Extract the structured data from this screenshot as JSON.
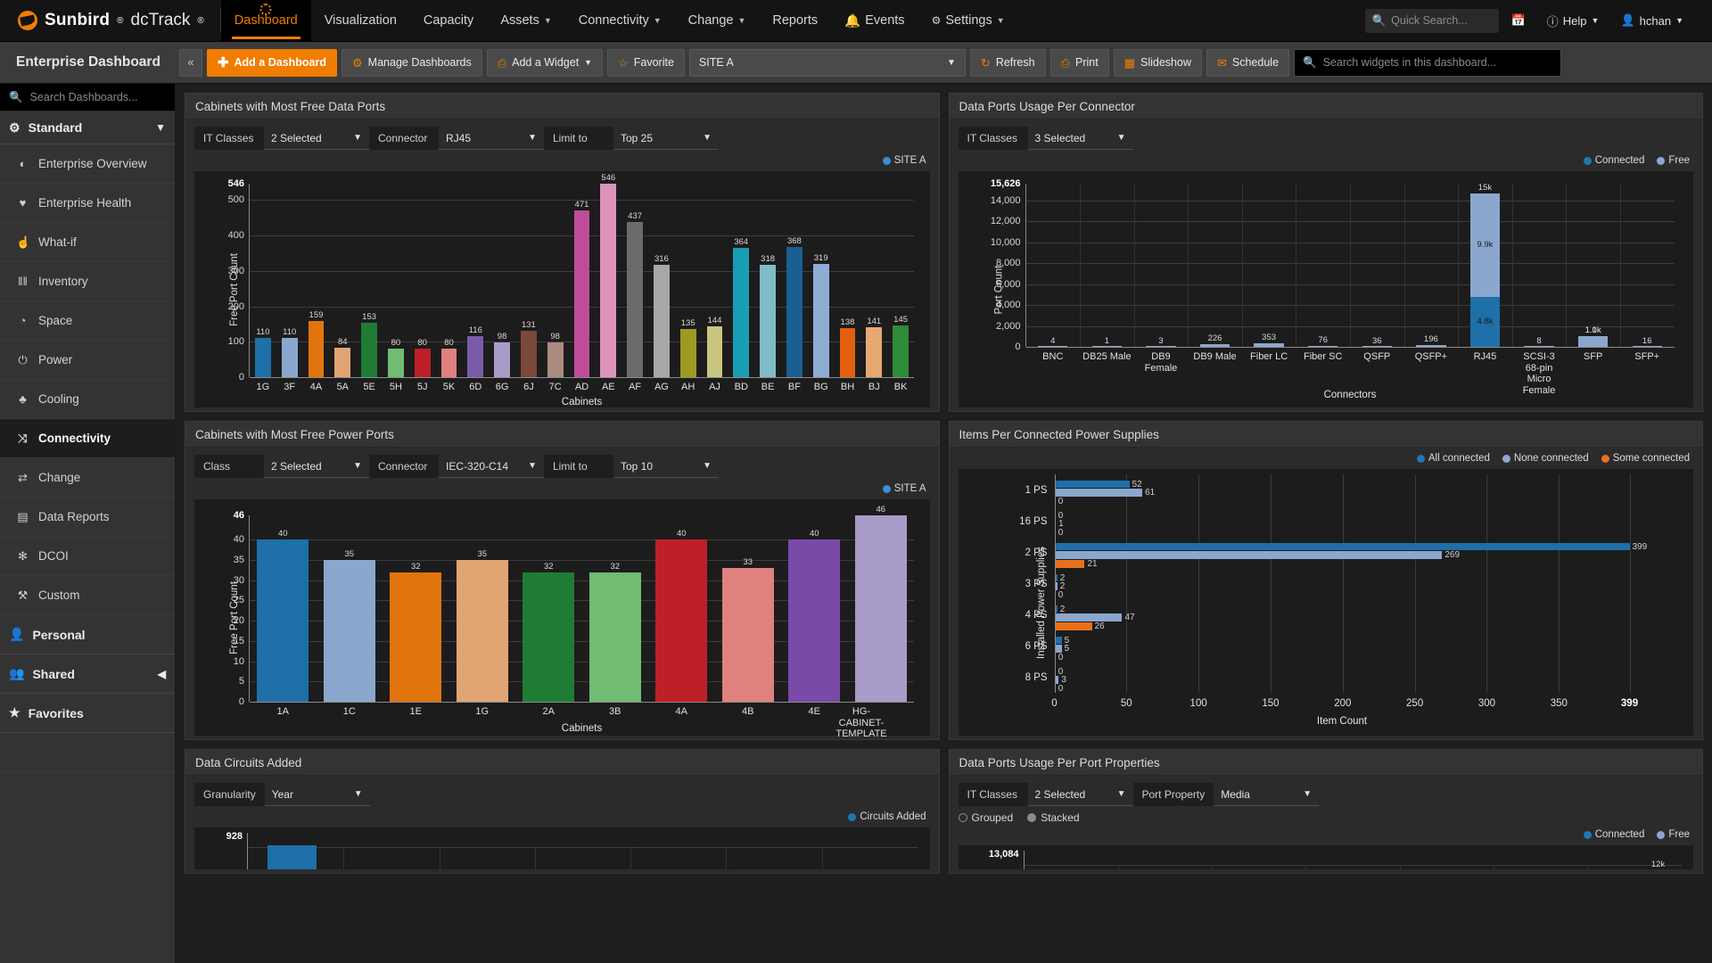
{
  "brand": {
    "name": "Sunbird",
    "sup": "®",
    "product": "dcTrack",
    "product_sup": "®"
  },
  "topnav": {
    "items": [
      {
        "label": "Dashboard",
        "caret": false,
        "active": true,
        "icon": ""
      },
      {
        "label": "Visualization",
        "caret": false,
        "active": false,
        "icon": ""
      },
      {
        "label": "Capacity",
        "caret": false,
        "active": false,
        "icon": ""
      },
      {
        "label": "Assets",
        "caret": true,
        "active": false,
        "icon": ""
      },
      {
        "label": "Connectivity",
        "caret": true,
        "active": false,
        "icon": ""
      },
      {
        "label": "Change",
        "caret": true,
        "active": false,
        "icon": ""
      },
      {
        "label": "Reports",
        "caret": false,
        "active": false,
        "icon": ""
      },
      {
        "label": "Events",
        "caret": false,
        "active": false,
        "icon": "bell"
      },
      {
        "label": "Settings",
        "caret": true,
        "active": false,
        "icon": "gear"
      }
    ],
    "quick_search_placeholder": "Quick Search...",
    "help_label": "Help",
    "user_label": "hchan"
  },
  "toolbar": {
    "title": "Enterprise Dashboard",
    "collapse_label": "«",
    "add_dashboard": "Add a Dashboard",
    "manage_dashboards": "Manage Dashboards",
    "add_widget": "Add a Widget",
    "favorite": "Favorite",
    "site_value": "SITE A",
    "refresh": "Refresh",
    "print": "Print",
    "slideshow": "Slideshow",
    "schedule": "Schedule",
    "widget_search_placeholder": "Search widgets in this dashboard..."
  },
  "sidebar": {
    "search_placeholder": "Search Dashboards...",
    "group_label": "Standard",
    "items": [
      {
        "label": "Enterprise Overview",
        "icon": "globe-icon",
        "glyph": "◐"
      },
      {
        "label": "Enterprise Health",
        "icon": "heartbeat-icon",
        "glyph": "♥"
      },
      {
        "label": "What-if",
        "icon": "thumbs-up-icon",
        "glyph": "☝"
      },
      {
        "label": "Inventory",
        "icon": "bars-icon",
        "glyph": "‖‖"
      },
      {
        "label": "Space",
        "icon": "gauge-icon",
        "glyph": "◔"
      },
      {
        "label": "Power",
        "icon": "power-icon",
        "glyph": "⏻"
      },
      {
        "label": "Cooling",
        "icon": "droplet-icon",
        "glyph": "♣"
      },
      {
        "label": "Connectivity",
        "icon": "shuffle-icon",
        "glyph": "⤨",
        "active": true
      },
      {
        "label": "Change",
        "icon": "exchange-icon",
        "glyph": "⇄"
      },
      {
        "label": "Data Reports",
        "icon": "report-icon",
        "glyph": "▤"
      },
      {
        "label": "DCOI",
        "icon": "asterisk-icon",
        "glyph": "✻"
      },
      {
        "label": "Custom",
        "icon": "wrench-icon",
        "glyph": "⚒"
      }
    ],
    "personal_label": "Personal",
    "shared_label": "Shared",
    "favorites_label": "Favorites"
  },
  "colors": {
    "accent": "#f07d00",
    "connected": "#1f77b4",
    "free": "#8ba7ce",
    "some_connected": "#e8701a",
    "site_a": "#3b8fd4"
  },
  "widgets": [
    {
      "title": "Cabinets with Most Free Data Ports",
      "filters": [
        {
          "label": "IT Classes",
          "value": "2 Selected"
        },
        {
          "label": "Connector",
          "value": "RJ45"
        },
        {
          "label": "Limit to",
          "value": "Top 25"
        }
      ],
      "legend": [
        {
          "label": "SITE A",
          "color": "#3b8fd4"
        }
      ]
    },
    {
      "title": "Data Ports Usage Per Connector",
      "filters": [
        {
          "label": "IT Classes",
          "value": "3 Selected"
        }
      ],
      "legend": [
        {
          "label": "Connected",
          "color": "#1f77b4"
        },
        {
          "label": "Free",
          "color": "#8ba7ce"
        }
      ]
    },
    {
      "title": "Cabinets with Most Free Power Ports",
      "filters": [
        {
          "label": "Class",
          "value": "2 Selected"
        },
        {
          "label": "Connector",
          "value": "IEC-320-C14"
        },
        {
          "label": "Limit to",
          "value": "Top 10"
        }
      ],
      "legend": [
        {
          "label": "SITE A",
          "color": "#3b8fd4"
        }
      ]
    },
    {
      "title": "Items Per Connected Power Supplies",
      "filters": [],
      "legend": [
        {
          "label": "All connected",
          "color": "#1f77b4"
        },
        {
          "label": "None connected",
          "color": "#8ba7ce"
        },
        {
          "label": "Some connected",
          "color": "#e8701a"
        }
      ]
    },
    {
      "title": "Data Circuits Added",
      "filters": [
        {
          "label": "Granularity",
          "value": "Year"
        }
      ],
      "legend": [
        {
          "label": "Circuits Added",
          "color": "#1f77b4"
        }
      ]
    },
    {
      "title": "Data Ports Usage Per Port Properties",
      "filters": [
        {
          "label": "IT Classes",
          "value": "2 Selected"
        },
        {
          "label": "Port Property",
          "value": "Media"
        }
      ],
      "radios": [
        {
          "label": "Grouped",
          "selected": false
        },
        {
          "label": "Stacked",
          "selected": true
        }
      ],
      "legend": [
        {
          "label": "Connected",
          "color": "#1f77b4"
        },
        {
          "label": "Free",
          "color": "#8ba7ce"
        }
      ]
    }
  ],
  "chart_data": [
    {
      "type": "bar",
      "title": "Cabinets with Most Free Data Ports",
      "xlabel": "Cabinets",
      "ylabel": "Free Port Count",
      "ylim": [
        0,
        546
      ],
      "yticks": [
        0,
        100,
        200,
        300,
        400,
        500
      ],
      "ymax_label": "546",
      "grid": true,
      "categories": [
        "1G",
        "3F",
        "4A",
        "5A",
        "5E",
        "5H",
        "5J",
        "5K",
        "6D",
        "6G",
        "6J",
        "7C",
        "AD",
        "AE",
        "AF",
        "AG",
        "AH",
        "AJ",
        "BD",
        "BE",
        "BF",
        "BG",
        "BH",
        "BJ",
        "BK"
      ],
      "values": [
        110,
        110,
        159,
        84,
        153,
        80,
        80,
        80,
        116,
        98,
        131,
        98,
        471,
        546,
        437,
        316,
        135,
        144,
        364,
        318,
        368,
        319,
        138,
        141,
        145
      ],
      "bar_colors": [
        "#1f6fa8",
        "#8aa8cd",
        "#e2740d",
        "#e0a572",
        "#1f7d33",
        "#6fbc72",
        "#bf2027",
        "#e0817f",
        "#7a5ba8",
        "#a89bc8",
        "#7a4a38",
        "#ab8a80",
        "#bf4c9b",
        "#dd93b9",
        "#6b6b6b",
        "#a8a8a8",
        "#9d9a1f",
        "#c8c67e",
        "#199db5",
        "#7fbdc8",
        "#1a5f93",
        "#8fadd4",
        "#e2600d",
        "#e8a871",
        "#2e8b36"
      ]
    },
    {
      "type": "bar",
      "stacked": true,
      "title": "Data Ports Usage Per Connector",
      "xlabel": "Connectors",
      "ylabel": "Port Count",
      "ylim": [
        0,
        15626
      ],
      "yticks": [
        0,
        2000,
        4000,
        6000,
        8000,
        10000,
        12000,
        14000
      ],
      "ytick_labels": [
        "0",
        "2,000",
        "4,000",
        "6,000",
        "8,000",
        "10,000",
        "12,000",
        "14,000"
      ],
      "ymax_label": "15,626",
      "grid": true,
      "categories": [
        "BNC",
        "DB25 Male",
        "DB9\nFemale",
        "DB9 Male",
        "Fiber LC",
        "Fiber SC",
        "QSFP",
        "QSFP+",
        "RJ45",
        "SCSI-3\n68-pin\nMicro\nFemale",
        "SFP",
        "SFP+"
      ],
      "series": [
        {
          "name": "Connected",
          "color": "#1f6fa8",
          "values": [
            0,
            0,
            0,
            0,
            0,
            0,
            0,
            0,
            4800,
            0,
            0,
            0
          ],
          "labels": [
            "",
            "",
            "",
            "",
            "",
            "",
            "",
            "",
            "4.8k",
            "",
            "",
            ""
          ]
        },
        {
          "name": "Free",
          "color": "#8ba7ce",
          "values": [
            4,
            1,
            3,
            226,
            353,
            76,
            36,
            196,
            9900,
            8,
            1000,
            16
          ],
          "labels": [
            "4",
            "1",
            "3",
            "226",
            "353",
            "76",
            "36",
            "196",
            "9.9k",
            "8",
            "1.0k",
            "16"
          ]
        }
      ],
      "total_labels": [
        "",
        "",
        "",
        "",
        "",
        "",
        "",
        "",
        "15k",
        "",
        "1.1k",
        ""
      ]
    },
    {
      "type": "bar",
      "title": "Cabinets with Most Free Power Ports",
      "xlabel": "Cabinets",
      "ylabel": "Free Port Count",
      "ylim": [
        0,
        46
      ],
      "yticks": [
        0,
        5,
        10,
        15,
        20,
        25,
        30,
        35,
        40
      ],
      "ymax_label": "46",
      "grid": true,
      "categories": [
        "1A",
        "1C",
        "1E",
        "1G",
        "2A",
        "3B",
        "4A",
        "4B",
        "4E",
        "HG-CABINET-TEMPLATE"
      ],
      "values": [
        40,
        35,
        32,
        35,
        32,
        32,
        40,
        33,
        40,
        46
      ],
      "bar_colors": [
        "#1f6fa8",
        "#8aa8cd",
        "#e2740d",
        "#e0a572",
        "#1f7d33",
        "#6fbc72",
        "#bf2027",
        "#e0817f",
        "#7a4aa8",
        "#a89bc8"
      ]
    },
    {
      "type": "bar",
      "orientation": "horizontal",
      "title": "Items Per Connected Power Supplies",
      "xlabel": "Item Count",
      "ylabel": "Installed Power Supplies",
      "xlim": [
        0,
        399
      ],
      "xticks": [
        0,
        50,
        100,
        150,
        200,
        250,
        300,
        350,
        399
      ],
      "grid": true,
      "categories": [
        "1 PS",
        "16 PS",
        "2 PS",
        "3 PS",
        "4 PS",
        "6 PS",
        "8 PS"
      ],
      "series": [
        {
          "name": "All connected",
          "color": "#1f6fa8",
          "values": [
            52,
            0,
            399,
            2,
            2,
            5,
            0
          ]
        },
        {
          "name": "None connected",
          "color": "#8ba7ce",
          "values": [
            61,
            1,
            269,
            2,
            47,
            5,
            3
          ]
        },
        {
          "name": "Some connected",
          "color": "#e8701a",
          "values": [
            0,
            0,
            21,
            0,
            26,
            0,
            0
          ]
        }
      ]
    },
    {
      "type": "bar",
      "title": "Data Circuits Added",
      "ylim": [
        0,
        928
      ],
      "ymax_label": "928",
      "values": [
        928
      ],
      "bar_colors": [
        "#1f6fa8"
      ]
    },
    {
      "type": "bar",
      "stacked": true,
      "title": "Data Ports Usage Per Port Properties",
      "ylim": [
        0,
        13084
      ],
      "ymax_label": "13,084",
      "values": [
        12000
      ],
      "value_labels": [
        "12k"
      ],
      "bar_colors": [
        "#8ba7ce"
      ]
    }
  ]
}
